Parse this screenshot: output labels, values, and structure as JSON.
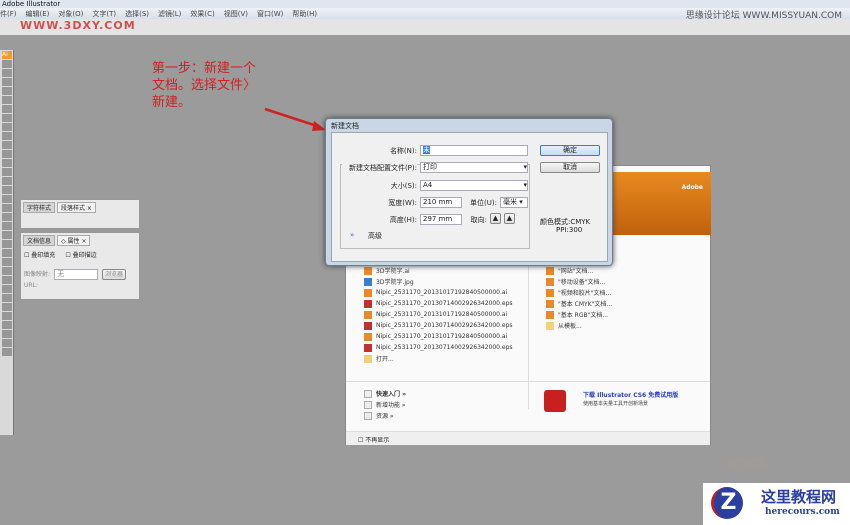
{
  "app_title": "Adobe Illustrator",
  "menu": [
    "件(F)",
    "编辑(E)",
    "对象(O)",
    "文字(T)",
    "选择(S)",
    "滤镜(L)",
    "效果(C)",
    "视图(V)",
    "窗口(W)",
    "帮助(H)"
  ],
  "watermarks": {
    "site": "WWW.3DXY.COM",
    "forum": "思缘设计论坛 WWW.MISSYUAN.COM",
    "brand_cn": "这里教程网",
    "brand_en": "herecours.com",
    "logo": "3D学院"
  },
  "annotation": "第一步：新建一个文档。选择文件〉新建。",
  "toolbar": {
    "ai_label": "Ai"
  },
  "panels": {
    "top_tabs": [
      "字符样式",
      "段落样式 ×"
    ],
    "bottom_tabs": [
      "文档信息",
      "◇ 属性 ×"
    ],
    "overprint_fill": "叠印填充",
    "overprint_stroke": "叠印描边",
    "image_map_label": "图像映射:",
    "image_map_value": "无",
    "browser_button": "浏览器",
    "url_label": "URL:"
  },
  "welcome": {
    "recent": [
      {
        "name": "3D学院字.ai",
        "type": "ai"
      },
      {
        "name": "3D学院字.jpg",
        "type": "jpg"
      },
      {
        "name": "Nipic_2531170_20131017192840500000.ai",
        "type": "ai"
      },
      {
        "name": "Nipic_2531170_20130714002926342000.eps",
        "type": "eps"
      },
      {
        "name": "Nipic_2531170_20131017192840500000.ai",
        "type": "ai"
      },
      {
        "name": "Nipic_2531170_20130714002926342000.eps",
        "type": "eps"
      },
      {
        "name": "Nipic_2531170_20131017192840500000.ai",
        "type": "ai"
      },
      {
        "name": "Nipic_2531170_20130714002926342000.eps",
        "type": "eps"
      },
      {
        "name": "打开...",
        "type": "fold"
      }
    ],
    "create": [
      {
        "name": "\"网站\"文档...",
        "type": "ai"
      },
      {
        "name": "\"移动设备\"文档...",
        "type": "ai"
      },
      {
        "name": "\"视频和胶片\"文档...",
        "type": "ai"
      },
      {
        "name": "\"基本 CMYK\"文档...",
        "type": "ai"
      },
      {
        "name": "\"基本 RGB\"文档...",
        "type": "ai"
      },
      {
        "name": "从模板...",
        "type": "fold"
      }
    ],
    "links": [
      "快速入门 »",
      "新增功能 »",
      "资源 »"
    ],
    "promo_title": "下载 Illustrator CS6 免费试用版",
    "promo_sub": "使用基本矢量工具开创新场景",
    "adobe": "Adobe",
    "dont_show": "不再显示"
  },
  "dialog": {
    "title": "新建文档",
    "name_label": "名称(N):",
    "name_value": "未",
    "profile_label": "新建文档配置文件(P):",
    "profile_value": "打印",
    "size_label": "大小(S):",
    "size_value": "A4",
    "width_label": "宽度(W):",
    "width_value": "210 mm",
    "units_label": "单位(U):",
    "units_value": "毫米",
    "height_label": "高度(H):",
    "height_value": "297 mm",
    "orientation_label": "取向:",
    "advanced_label": "高级",
    "ok": "确定",
    "cancel": "取消",
    "color_mode": "颜色模式:CMYK",
    "ppi": "PPI:300"
  }
}
